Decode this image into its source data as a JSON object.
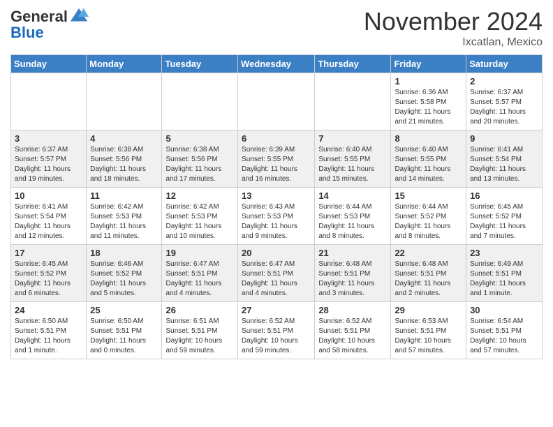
{
  "logo": {
    "general": "General",
    "blue": "Blue"
  },
  "header": {
    "month": "November 2024",
    "location": "Ixcatlan, Mexico"
  },
  "days_of_week": [
    "Sunday",
    "Monday",
    "Tuesday",
    "Wednesday",
    "Thursday",
    "Friday",
    "Saturday"
  ],
  "weeks": [
    [
      {
        "day": "",
        "info": ""
      },
      {
        "day": "",
        "info": ""
      },
      {
        "day": "",
        "info": ""
      },
      {
        "day": "",
        "info": ""
      },
      {
        "day": "",
        "info": ""
      },
      {
        "day": "1",
        "info": "Sunrise: 6:36 AM\nSunset: 5:58 PM\nDaylight: 11 hours and 21 minutes."
      },
      {
        "day": "2",
        "info": "Sunrise: 6:37 AM\nSunset: 5:57 PM\nDaylight: 11 hours and 20 minutes."
      }
    ],
    [
      {
        "day": "3",
        "info": "Sunrise: 6:37 AM\nSunset: 5:57 PM\nDaylight: 11 hours and 19 minutes."
      },
      {
        "day": "4",
        "info": "Sunrise: 6:38 AM\nSunset: 5:56 PM\nDaylight: 11 hours and 18 minutes."
      },
      {
        "day": "5",
        "info": "Sunrise: 6:38 AM\nSunset: 5:56 PM\nDaylight: 11 hours and 17 minutes."
      },
      {
        "day": "6",
        "info": "Sunrise: 6:39 AM\nSunset: 5:55 PM\nDaylight: 11 hours and 16 minutes."
      },
      {
        "day": "7",
        "info": "Sunrise: 6:40 AM\nSunset: 5:55 PM\nDaylight: 11 hours and 15 minutes."
      },
      {
        "day": "8",
        "info": "Sunrise: 6:40 AM\nSunset: 5:55 PM\nDaylight: 11 hours and 14 minutes."
      },
      {
        "day": "9",
        "info": "Sunrise: 6:41 AM\nSunset: 5:54 PM\nDaylight: 11 hours and 13 minutes."
      }
    ],
    [
      {
        "day": "10",
        "info": "Sunrise: 6:41 AM\nSunset: 5:54 PM\nDaylight: 11 hours and 12 minutes."
      },
      {
        "day": "11",
        "info": "Sunrise: 6:42 AM\nSunset: 5:53 PM\nDaylight: 11 hours and 11 minutes."
      },
      {
        "day": "12",
        "info": "Sunrise: 6:42 AM\nSunset: 5:53 PM\nDaylight: 11 hours and 10 minutes."
      },
      {
        "day": "13",
        "info": "Sunrise: 6:43 AM\nSunset: 5:53 PM\nDaylight: 11 hours and 9 minutes."
      },
      {
        "day": "14",
        "info": "Sunrise: 6:44 AM\nSunset: 5:53 PM\nDaylight: 11 hours and 8 minutes."
      },
      {
        "day": "15",
        "info": "Sunrise: 6:44 AM\nSunset: 5:52 PM\nDaylight: 11 hours and 8 minutes."
      },
      {
        "day": "16",
        "info": "Sunrise: 6:45 AM\nSunset: 5:52 PM\nDaylight: 11 hours and 7 minutes."
      }
    ],
    [
      {
        "day": "17",
        "info": "Sunrise: 6:45 AM\nSunset: 5:52 PM\nDaylight: 11 hours and 6 minutes."
      },
      {
        "day": "18",
        "info": "Sunrise: 6:46 AM\nSunset: 5:52 PM\nDaylight: 11 hours and 5 minutes."
      },
      {
        "day": "19",
        "info": "Sunrise: 6:47 AM\nSunset: 5:51 PM\nDaylight: 11 hours and 4 minutes."
      },
      {
        "day": "20",
        "info": "Sunrise: 6:47 AM\nSunset: 5:51 PM\nDaylight: 11 hours and 4 minutes."
      },
      {
        "day": "21",
        "info": "Sunrise: 6:48 AM\nSunset: 5:51 PM\nDaylight: 11 hours and 3 minutes."
      },
      {
        "day": "22",
        "info": "Sunrise: 6:48 AM\nSunset: 5:51 PM\nDaylight: 11 hours and 2 minutes."
      },
      {
        "day": "23",
        "info": "Sunrise: 6:49 AM\nSunset: 5:51 PM\nDaylight: 11 hours and 1 minute."
      }
    ],
    [
      {
        "day": "24",
        "info": "Sunrise: 6:50 AM\nSunset: 5:51 PM\nDaylight: 11 hours and 1 minute."
      },
      {
        "day": "25",
        "info": "Sunrise: 6:50 AM\nSunset: 5:51 PM\nDaylight: 11 hours and 0 minutes."
      },
      {
        "day": "26",
        "info": "Sunrise: 6:51 AM\nSunset: 5:51 PM\nDaylight: 10 hours and 59 minutes."
      },
      {
        "day": "27",
        "info": "Sunrise: 6:52 AM\nSunset: 5:51 PM\nDaylight: 10 hours and 59 minutes."
      },
      {
        "day": "28",
        "info": "Sunrise: 6:52 AM\nSunset: 5:51 PM\nDaylight: 10 hours and 58 minutes."
      },
      {
        "day": "29",
        "info": "Sunrise: 6:53 AM\nSunset: 5:51 PM\nDaylight: 10 hours and 57 minutes."
      },
      {
        "day": "30",
        "info": "Sunrise: 6:54 AM\nSunset: 5:51 PM\nDaylight: 10 hours and 57 minutes."
      }
    ]
  ]
}
